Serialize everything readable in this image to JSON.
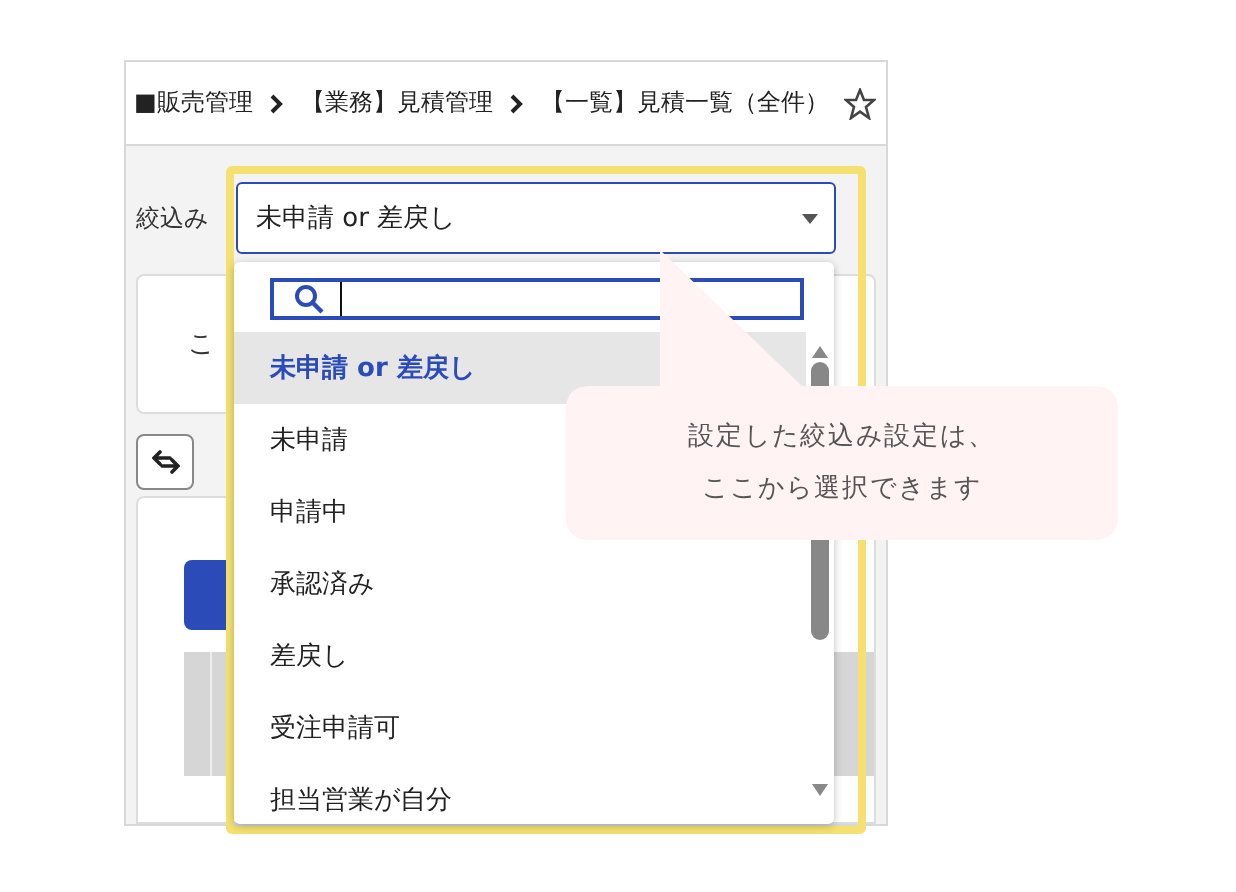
{
  "breadcrumb": [
    {
      "label": "■販売管理"
    },
    {
      "label": "【業務】見積管理"
    },
    {
      "label": "【一覧】見積一覧（全件）"
    }
  ],
  "filter": {
    "label": "絞込み",
    "value": "未申請 or 差戻し",
    "expanded": true
  },
  "background": {
    "notice": "こ"
  },
  "options": [
    {
      "label": "未申請 or 差戻し",
      "selected": true
    },
    {
      "label": "未申請",
      "selected": false
    },
    {
      "label": "申請中",
      "selected": false
    },
    {
      "label": "承認済み",
      "selected": false
    },
    {
      "label": "差戻し",
      "selected": false
    },
    {
      "label": "受注申請可",
      "selected": false
    },
    {
      "label": "担当営業が自分",
      "selected": false
    }
  ],
  "highlight": {
    "on": true
  },
  "callout": {
    "lines": [
      "設定した絞込み設定は、",
      "ここから選択できます"
    ]
  }
}
